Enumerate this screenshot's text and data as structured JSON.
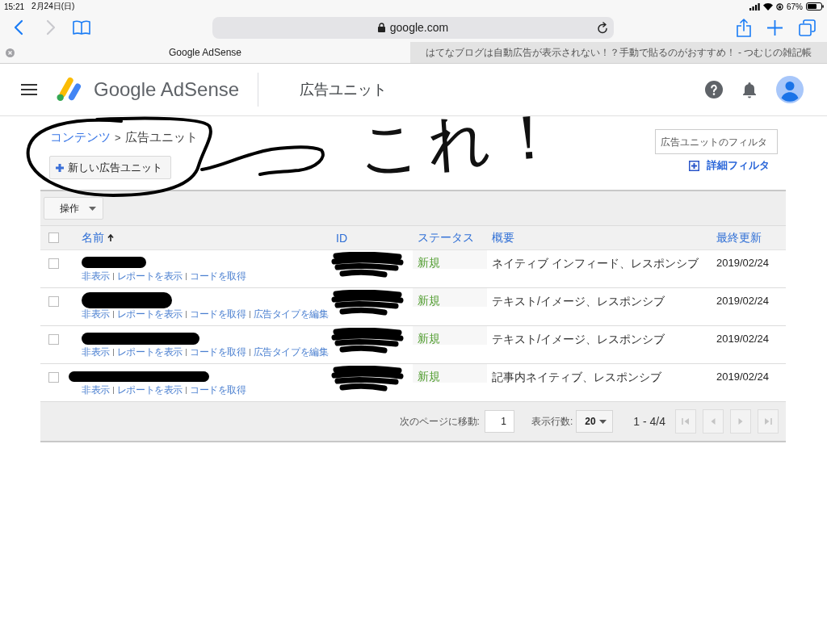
{
  "status_bar": {
    "time": "15:21",
    "date": "2月24日(日)",
    "battery": "67%"
  },
  "browser": {
    "url": "google.com",
    "forward_disabled": true,
    "tabs": [
      {
        "title": "Google AdSense",
        "selected": true
      },
      {
        "title": "はてなブログは自動広告が表示されない！？手動で貼るのがおすすめ！ - つむじの雑記帳",
        "selected": false
      }
    ]
  },
  "header": {
    "product": "Google AdSense",
    "page_title": "広告ユニット"
  },
  "breadcrumb": {
    "separator": ">",
    "items": [
      {
        "label": "コンテンツ",
        "kind": "link"
      },
      {
        "label": "広告ユニット",
        "kind": "current"
      }
    ]
  },
  "new_button": "新しい広告ユニット",
  "filter": {
    "placeholder": "広告ユニットのフィルタ",
    "advanced_link": "詳細フィルタ"
  },
  "actions_menu": "操作",
  "table": {
    "all_checked": false,
    "columns": [
      {
        "label": "名前",
        "sorted": true
      },
      {
        "label": "ID",
        "sorted": false
      },
      {
        "label": "ステータス",
        "sorted": false
      },
      {
        "label": "概要",
        "sorted": false
      },
      {
        "label": "最終更新",
        "sorted": false
      }
    ],
    "rows": [
      {
        "checked": false,
        "status": "新規",
        "summary": "ネイティブ インフィード、レスポンシブ",
        "updated": "2019/02/24",
        "links": [
          "非表示",
          "レポートを表示",
          "コードを取得"
        ]
      },
      {
        "checked": false,
        "status": "新規",
        "summary": "テキスト/イメージ、レスポンシブ",
        "updated": "2019/02/24",
        "links": [
          "非表示",
          "レポートを表示",
          "コードを取得",
          "広告タイプを編集"
        ]
      },
      {
        "checked": false,
        "status": "新規",
        "summary": "テキスト/イメージ、レスポンシブ",
        "updated": "2019/02/24",
        "links": [
          "非表示",
          "レポートを表示",
          "コードを取得",
          "広告タイプを編集"
        ]
      },
      {
        "checked": false,
        "status": "新規",
        "summary": "記事内ネイティブ、レスポンシブ",
        "updated": "2019/02/24",
        "links": [
          "非表示",
          "レポートを表示",
          "コードを取得"
        ]
      }
    ]
  },
  "pagination": {
    "goto_label": "次のページに移動:",
    "page": "1",
    "rows_label": "表示行数:",
    "rows_per_page": "20",
    "range": "1 - 4/4",
    "nav_buttons": [
      {
        "kind": "first",
        "disabled": true
      },
      {
        "kind": "prev",
        "disabled": true
      },
      {
        "kind": "next",
        "disabled": true
      },
      {
        "kind": "last",
        "disabled": true
      }
    ]
  },
  "annotation": {
    "text": "これ！"
  }
}
